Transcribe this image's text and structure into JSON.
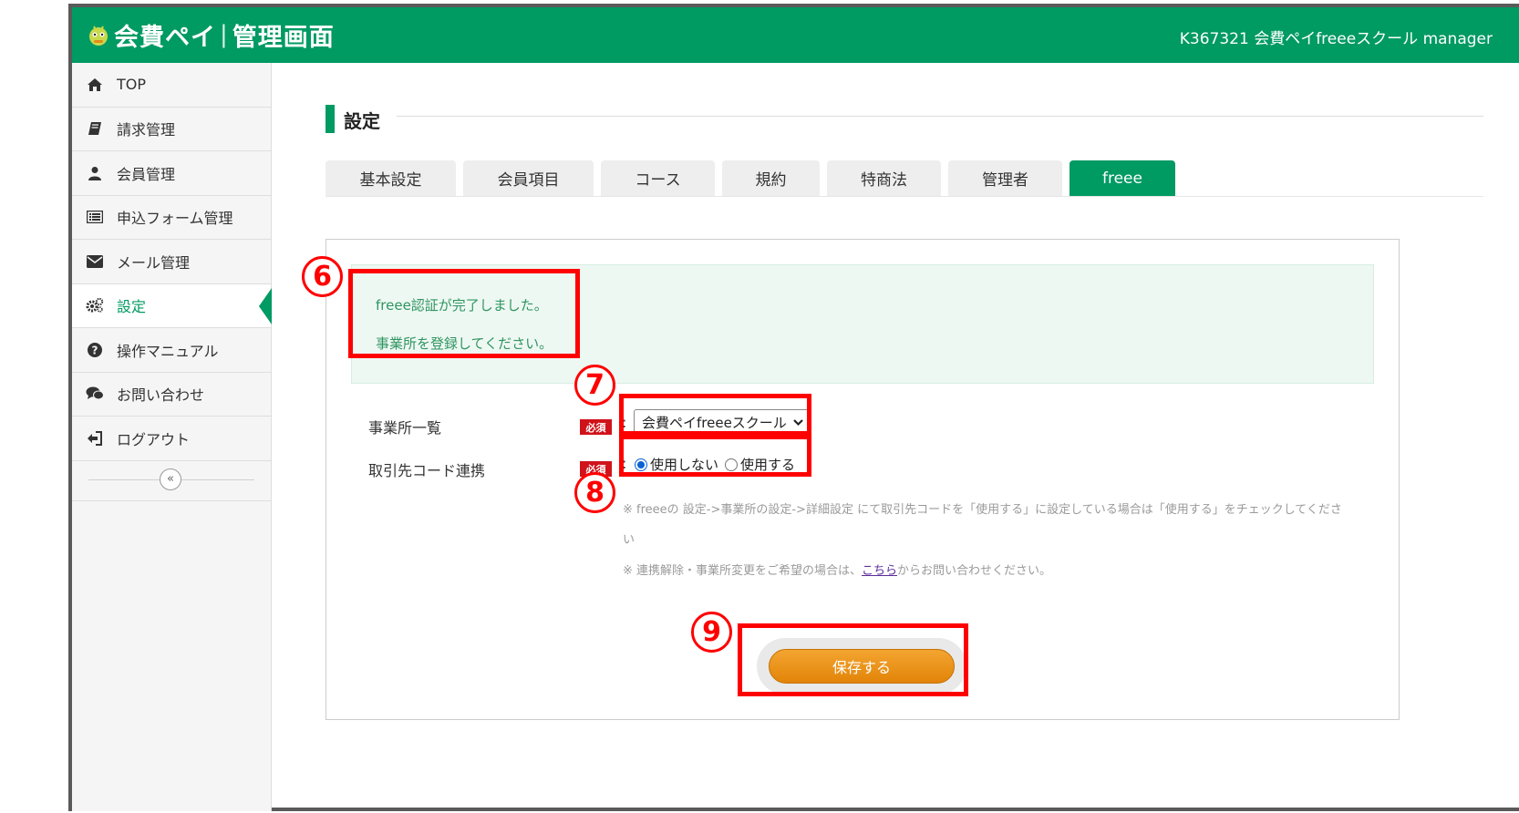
{
  "header": {
    "logo_main": "会費ペイ",
    "logo_sep": "|",
    "logo_sub": "管理画面",
    "user_info": "K367321 会費ペイfreeeスクール manager"
  },
  "sidebar": {
    "items": [
      {
        "label": "TOP",
        "icon": "home-icon"
      },
      {
        "label": "請求管理",
        "icon": "book-icon"
      },
      {
        "label": "会員管理",
        "icon": "user-icon"
      },
      {
        "label": "申込フォーム管理",
        "icon": "list-icon"
      },
      {
        "label": "メール管理",
        "icon": "envelope-icon"
      },
      {
        "label": "設定",
        "icon": "gears-icon",
        "active": true
      },
      {
        "label": "操作マニュアル",
        "icon": "question-icon"
      },
      {
        "label": "お問い合わせ",
        "icon": "comments-icon"
      },
      {
        "label": "ログアウト",
        "icon": "sign-out-icon"
      }
    ],
    "collapse_glyph": "«"
  },
  "page": {
    "title": "設定",
    "tabs": [
      {
        "label": "基本設定"
      },
      {
        "label": "会員項目"
      },
      {
        "label": "コース"
      },
      {
        "label": "規約"
      },
      {
        "label": "特商法"
      },
      {
        "label": "管理者"
      },
      {
        "label": "freee",
        "active": true
      }
    ]
  },
  "alert": {
    "line1": "freee認証が完了しました。",
    "line2": "事業所を登録してください。"
  },
  "form": {
    "required_badge": "必須",
    "colon": ":",
    "office_label": "事業所一覧",
    "office_value": "会費ペイfreeeスクール",
    "partner_label": "取引先コード連携",
    "radio_no": "使用しない",
    "radio_yes": "使用する",
    "radio_selected": "使用しない",
    "note1_line1": "※ freeeの 設定->事業所の設定->詳細設定 にて取引先コードを「使用する」に設定している場合は「使用する」をチェックしてくださ",
    "note1_line2": "い",
    "note2_pre": "※ 連携解除・事業所変更をご希望の場合は、",
    "note2_link": "こちら",
    "note2_post": "からお問い合わせください。",
    "save_label": "保存する"
  },
  "annotations": {
    "n6": "6",
    "n7": "7",
    "n8": "8",
    "n9": "9",
    "highlight_color": "#ff0000"
  },
  "colors": {
    "brand": "#009a63",
    "save": "#e8900f",
    "required": "#d0131b"
  }
}
